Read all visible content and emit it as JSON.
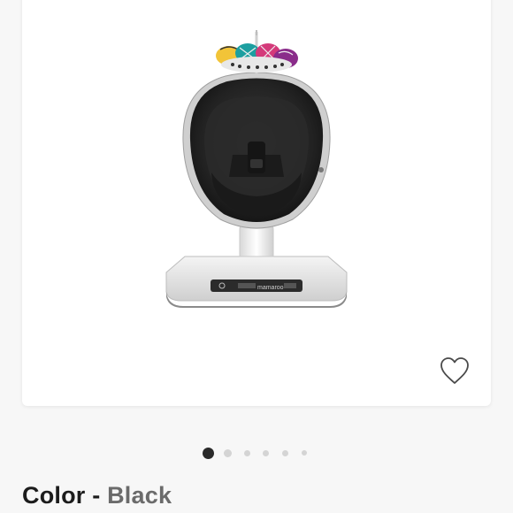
{
  "product": {
    "image_alt": "4moms mamaRoo infant seat in black",
    "brand_mark": "mamaroo",
    "wishlist_icon": "heart-outline-icon"
  },
  "carousel": {
    "total": 6,
    "active_index": 0
  },
  "color_selector": {
    "label": "Color",
    "separator": "-",
    "value": "Black"
  },
  "colors": {
    "page_bg": "#f7f7f7",
    "card_bg": "#ffffff",
    "dot_active": "#2a2a2a",
    "dot_inactive": "#d4d4d4",
    "label_text": "#1c1c1c",
    "value_text": "#6b6b6b"
  }
}
